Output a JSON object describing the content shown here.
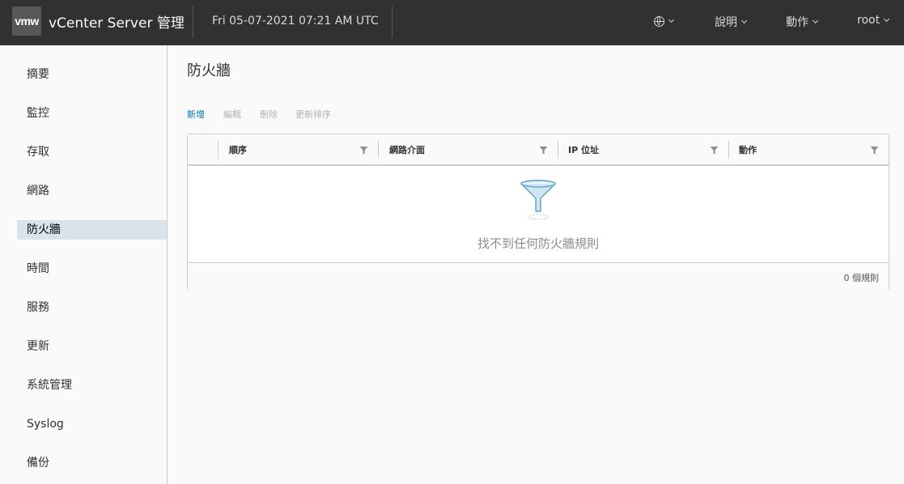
{
  "header": {
    "logo": "vmw",
    "title": "vCenter Server 管理",
    "datetime": "Fri 05-07-2021 07:21 AM UTC",
    "language_icon": "globe-icon",
    "help": "說明",
    "actions": "動作",
    "user": "root"
  },
  "sidebar": {
    "items": [
      {
        "label": "摘要"
      },
      {
        "label": "監控"
      },
      {
        "label": "存取"
      },
      {
        "label": "網路"
      },
      {
        "label": "防火牆"
      },
      {
        "label": "時間"
      },
      {
        "label": "服務"
      },
      {
        "label": "更新"
      },
      {
        "label": "系統管理"
      },
      {
        "label": "Syslog"
      },
      {
        "label": "備份"
      }
    ],
    "active": "防火牆"
  },
  "main": {
    "title": "防火牆",
    "toolbar": {
      "add": "新增",
      "edit": "編輯",
      "delete": "刪除",
      "reorder": "更新排序"
    },
    "grid": {
      "columns": [
        "順序",
        "網路介面",
        "IP 位址",
        "動作"
      ],
      "empty_message": "找不到任何防火牆規則",
      "footer": "0 個規則"
    }
  },
  "colors": {
    "header_bg": "#313131",
    "accent": "#0072a3",
    "active_nav_bg": "#d9e4ea"
  }
}
